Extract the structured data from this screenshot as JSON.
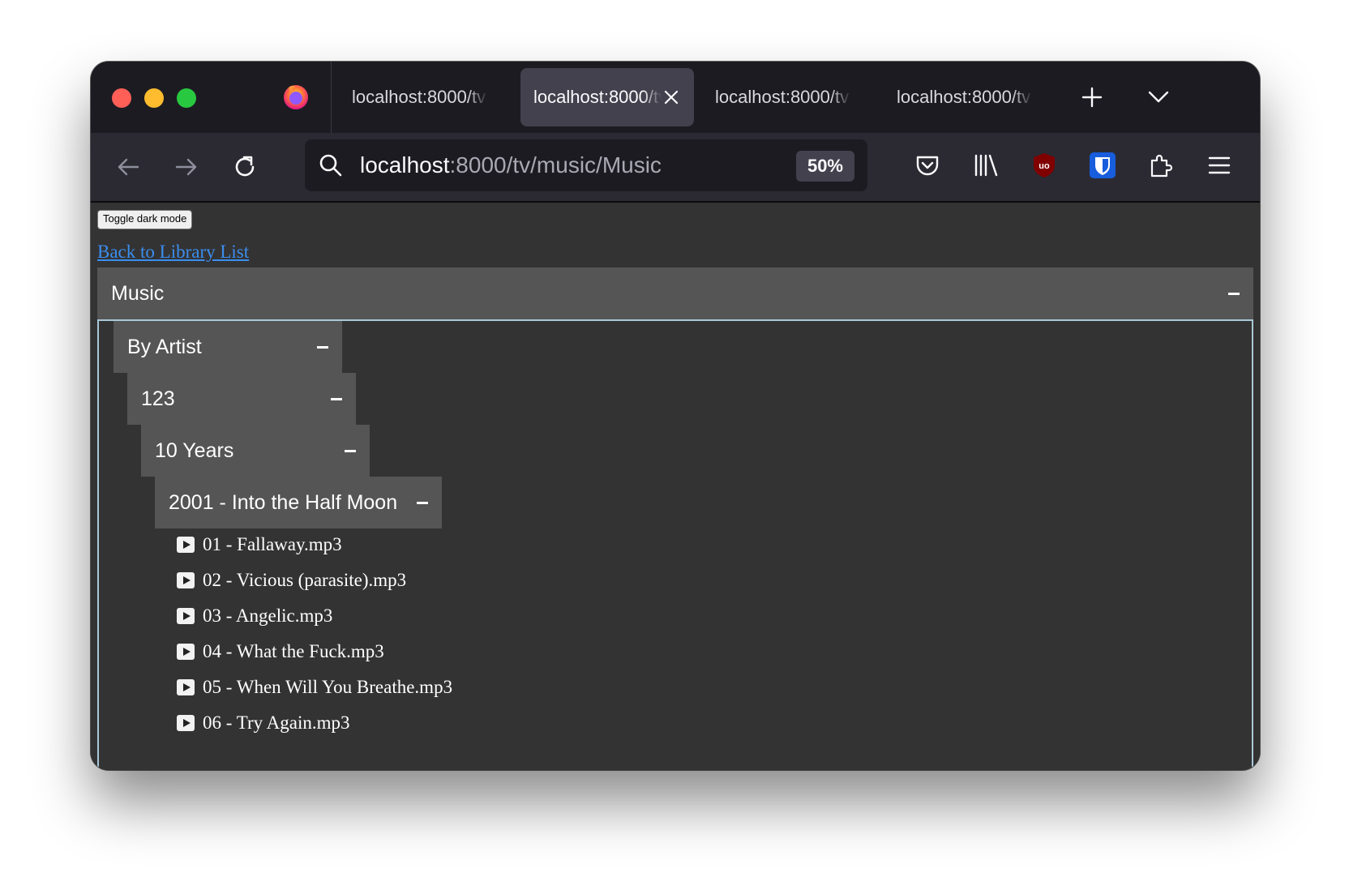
{
  "browser": {
    "tabs": [
      {
        "title": "localhost:8000/tv",
        "active": false
      },
      {
        "title": "localhost:8000/tv",
        "active": true
      },
      {
        "title": "localhost:8000/tv",
        "active": false
      },
      {
        "title": "localhost:8000/tv",
        "active": false
      }
    ],
    "url": {
      "host": "localhost",
      "rest": ":8000/tv/music/Music"
    },
    "zoom": "50%"
  },
  "page": {
    "toggle_label": "Toggle dark mode",
    "back_link": "Back to Library List",
    "section_title": "Music",
    "tree": {
      "level1": "By Artist",
      "level2": "123",
      "level3": "10 Years",
      "level4": "2001 - Into the Half Moon"
    },
    "tracks": [
      "01 - Fallaway.mp3",
      "02 - Vicious (parasite).mp3",
      "03 - Angelic.mp3",
      "04 - What the Fuck.mp3",
      "05 - When Will You Breathe.mp3",
      "06 - Try Again.mp3"
    ]
  }
}
